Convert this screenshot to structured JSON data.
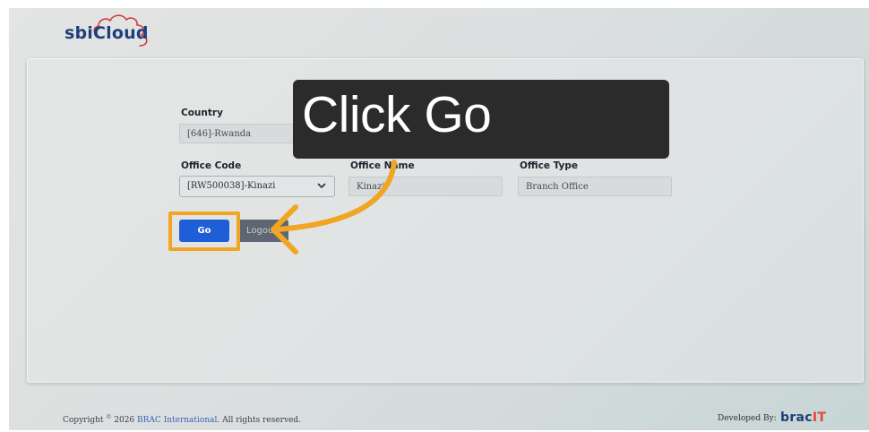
{
  "app": {
    "logo_text": "sbiCloud"
  },
  "form": {
    "country": {
      "label": "Country",
      "value": "[646]-Rwanda"
    },
    "office_code": {
      "label": "Office Code",
      "value": "[RW500038]-Kinazi"
    },
    "office_name": {
      "label": "Office Name",
      "value": "Kinazi"
    },
    "office_type": {
      "label": "Office Type",
      "value": "Branch Office"
    },
    "go_label": "Go",
    "logout_label": "Logout"
  },
  "callout": {
    "text": "Click Go"
  },
  "footer": {
    "copyright_prefix": "Copyright",
    "copyright_symbol": "©",
    "copyright_year": " 2026 ",
    "company": "BRAC International",
    "copyright_suffix": ". All rights reserved.",
    "developed_by": "Developed By:",
    "brand_main": "brac",
    "brand_it": "IT"
  },
  "colors": {
    "primary": "#1e5fd8",
    "highlight": "#f0a623",
    "brand_navy": "#1f3f7a",
    "brand_red": "#e8453c"
  },
  "icons": [
    "cloud-logo-icon",
    "chevron-down-icon",
    "curved-arrow-icon"
  ]
}
